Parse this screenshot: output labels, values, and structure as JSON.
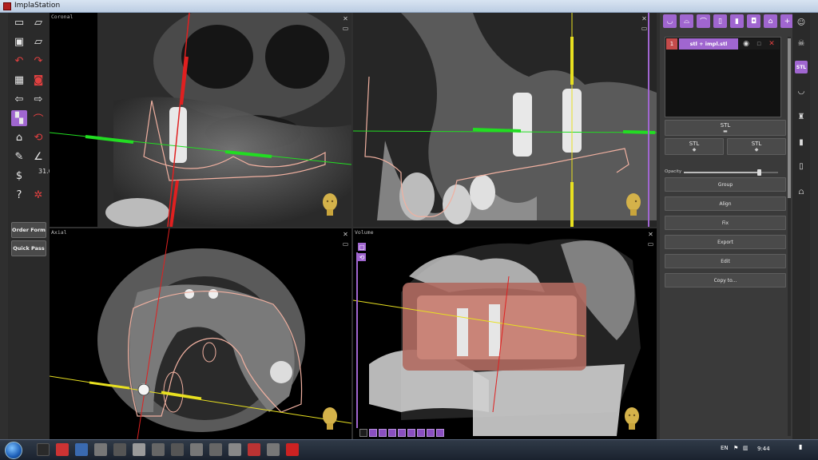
{
  "window": {
    "title": "ImplaStation"
  },
  "left_toolbar": {
    "numeric_readout": "31.0",
    "buttons": {
      "order_form": "Order Form",
      "quick_pass": "Quick Pass"
    }
  },
  "viewports": {
    "top_left": {
      "label": "Coronal"
    },
    "bottom_left": {
      "label": "Axial"
    },
    "bottom_right": {
      "label": "Volume"
    }
  },
  "right_panel": {
    "layers": [
      {
        "index": "1",
        "name": "stl + impl.stl"
      }
    ],
    "stl_main": {
      "label": "STL"
    },
    "stl_left": {
      "label": "STL"
    },
    "stl_right": {
      "label": "STL"
    },
    "opacity_label": "Opacity",
    "opacity_value": 0.8,
    "actions": [
      "Group",
      "Align",
      "Fix",
      "Export",
      "Edit",
      "Copy to..."
    ]
  },
  "far_right": {
    "active_label": "STL"
  },
  "taskbar": {
    "language": "EN",
    "time": "9:44"
  },
  "colors": {
    "accent": "#a066d0",
    "danger": "#c44b4b",
    "implant_line_red": "#e02020",
    "guide_green": "#22dd22",
    "guide_yellow": "#e8e020",
    "outline": "#f0b0a0"
  }
}
